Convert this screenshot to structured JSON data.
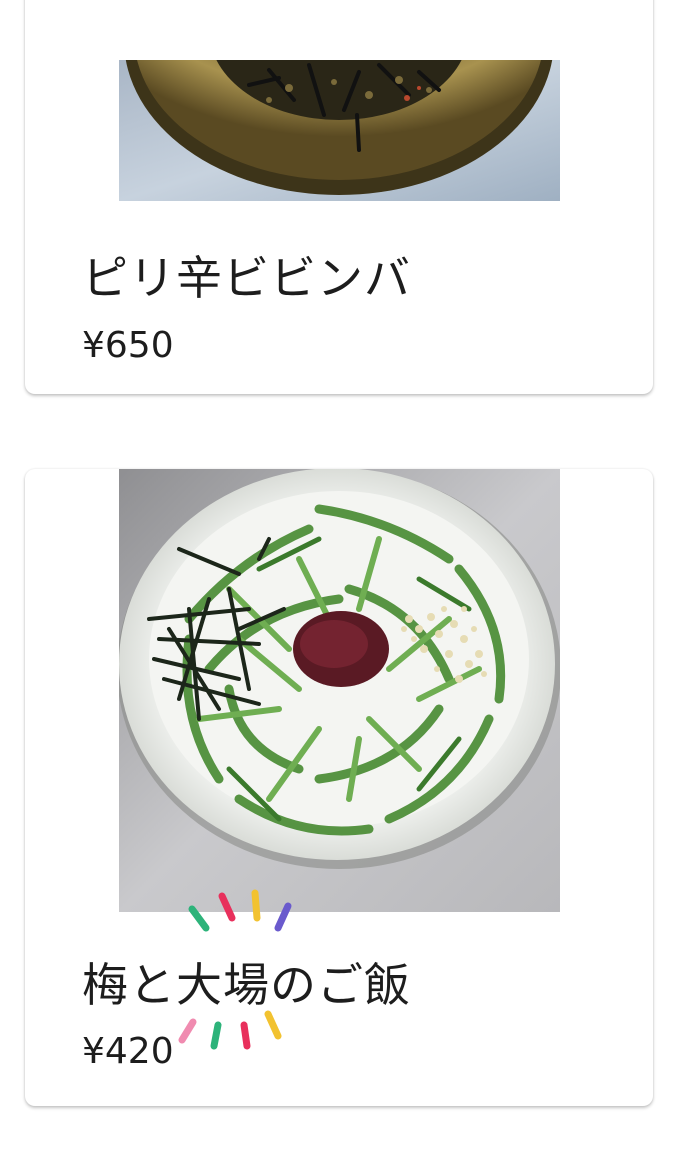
{
  "menu": {
    "items": [
      {
        "name": "ピリ辛ビビンバ",
        "price": "¥650",
        "image": "bibimbap-bowl-photo"
      },
      {
        "name": "梅と大場のご飯",
        "price": "¥420",
        "image": "ume-shiso-rice-bowl-photo"
      }
    ]
  },
  "colors": {
    "card_background": "#ffffff",
    "text": "#1d1d1d",
    "sparkle": [
      "#2db37a",
      "#e8305c",
      "#f2c230",
      "#6a5acd",
      "#f08bb0"
    ]
  }
}
